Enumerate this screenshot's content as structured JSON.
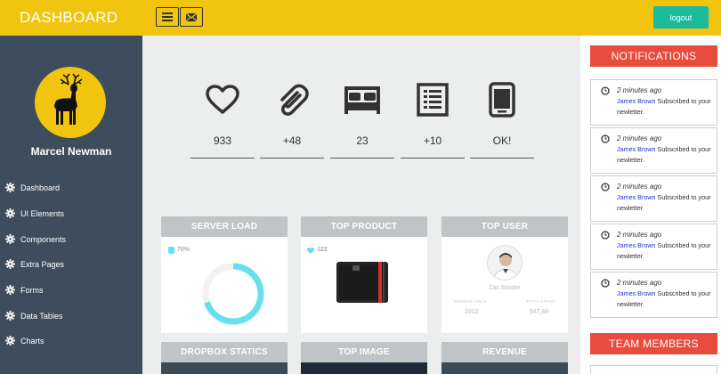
{
  "header": {
    "brand": "DASHBOARD",
    "logout_label": "logout"
  },
  "profile": {
    "name": "Marcel Newman"
  },
  "sidebar": {
    "items": [
      {
        "label": "Dashboard"
      },
      {
        "label": "UI Elements"
      },
      {
        "label": "Components"
      },
      {
        "label": "Extra Pages"
      },
      {
        "label": "Forms"
      },
      {
        "label": "Data Tables"
      },
      {
        "label": "Charts"
      }
    ]
  },
  "stats": [
    {
      "icon": "heart-icon",
      "value": "933"
    },
    {
      "icon": "paperclip-icon",
      "value": "+48"
    },
    {
      "icon": "bed-icon",
      "value": "23"
    },
    {
      "icon": "list-icon",
      "value": "+10"
    },
    {
      "icon": "phone-icon",
      "value": "OK!"
    }
  ],
  "cards": {
    "server_load": {
      "title": "SERVER LOAD",
      "percent_label": "70%",
      "percent": 0.7
    },
    "top_product": {
      "title": "TOP PRODUCT",
      "likes": "122"
    },
    "top_user": {
      "title": "TOP USER",
      "name": "Zac Snider",
      "member_since_label": "MEMBER SINCE",
      "member_since": "2012",
      "total_spend_label": "TOTAL SPEND",
      "total_spend": "$47,60"
    },
    "dropbox": {
      "title": "DROPBOX STATICS"
    },
    "top_image": {
      "title": "TOP IMAGE"
    },
    "revenue": {
      "title": "REVENUE"
    }
  },
  "notifications": {
    "title": "NOTIFICATIONS",
    "items": [
      {
        "time": "2 minutes ago",
        "who": "James Brown",
        "text": "Subscribed to your newletter."
      },
      {
        "time": "2 minutes ago",
        "who": "James Brown",
        "text": "Subscribed to your newletter."
      },
      {
        "time": "2 minutes ago",
        "who": "James Brown",
        "text": "Subscribed to your newletter."
      },
      {
        "time": "2 minutes ago",
        "who": "James Brown",
        "text": "Subscribed to your newletter."
      },
      {
        "time": "2 minutes ago",
        "who": "James Brown",
        "text": "Subscribed to your newletter."
      }
    ]
  },
  "team": {
    "title": "TEAM MEMBERS"
  },
  "colors": {
    "accent_yellow": "#f1c40f",
    "sidebar_bg": "#3d4d5d",
    "logout_green": "#1abc9c",
    "section_red": "#e74c3c",
    "donut_cyan": "#68dff0"
  }
}
